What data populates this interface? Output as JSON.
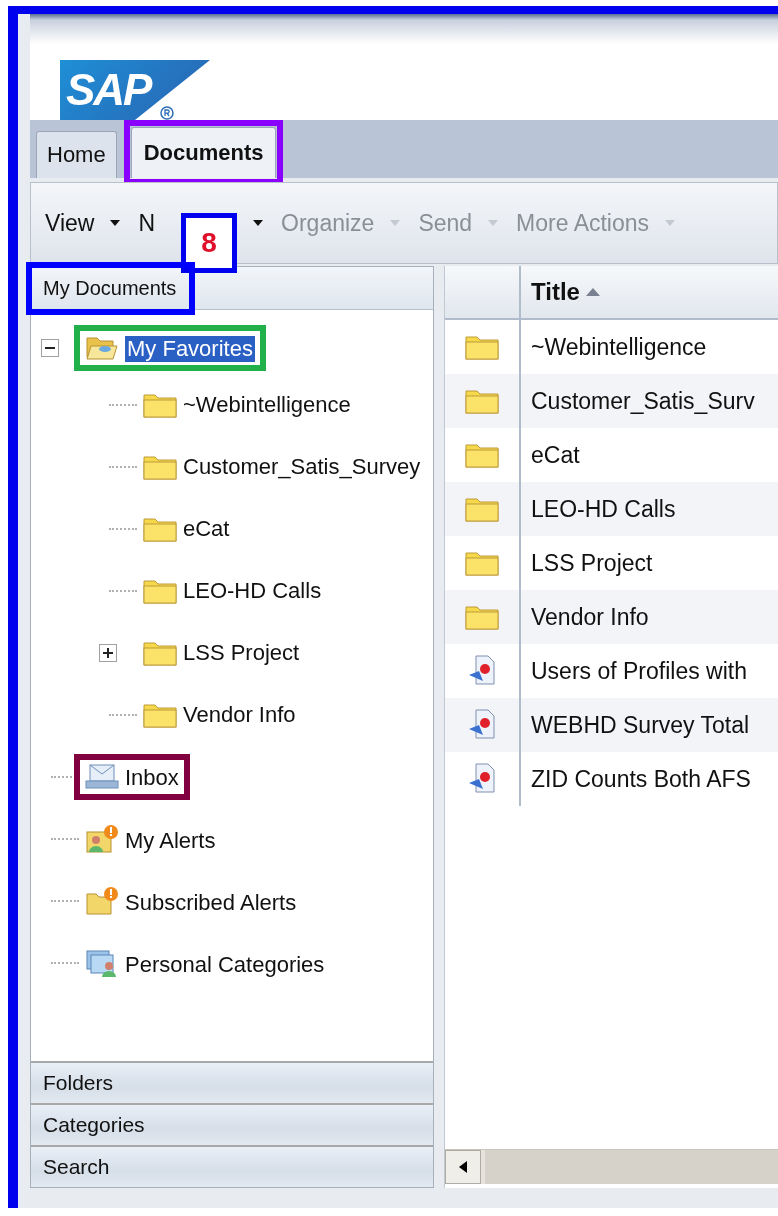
{
  "logo": "SAP",
  "tabs": [
    {
      "label": "Home",
      "selected": false
    },
    {
      "label": "Documents",
      "selected": true,
      "color": "#8a00ff"
    }
  ],
  "toolbar": [
    {
      "label": "View",
      "disabled": false
    },
    {
      "label": "N",
      "disabled": false
    },
    {
      "label": "Organize",
      "disabled": true
    },
    {
      "label": "Send",
      "disabled": true
    },
    {
      "label": "More Actions",
      "disabled": true
    }
  ],
  "callout": {
    "number": "8"
  },
  "left_panel": {
    "title": "My Documents",
    "color": "#0000ff",
    "tree": [
      {
        "label": "My Favorites",
        "kind": "open-folder",
        "expanded": true,
        "selected": true,
        "color": "#22b04a",
        "children": [
          {
            "label": "~Webintelligence",
            "kind": "folder"
          },
          {
            "label": "Customer_Satis_Survey",
            "kind": "folder"
          },
          {
            "label": "eCat",
            "kind": "folder"
          },
          {
            "label": "LEO-HD Calls",
            "kind": "folder"
          },
          {
            "label": "LSS Project",
            "kind": "folder",
            "expanded": false
          },
          {
            "label": "Vendor Info",
            "kind": "folder"
          }
        ]
      },
      {
        "label": "Inbox",
        "kind": "inbox",
        "color": "#800040"
      },
      {
        "label": "My Alerts",
        "kind": "alert-person"
      },
      {
        "label": "Subscribed Alerts",
        "kind": "alert-folder"
      },
      {
        "label": "Personal Categories",
        "kind": "categories"
      }
    ],
    "accordion": [
      "Folders",
      "Categories",
      "Search"
    ]
  },
  "table": {
    "columns": [
      "Title"
    ],
    "rows": [
      {
        "kind": "folder",
        "title": "~Webintelligence"
      },
      {
        "kind": "folder",
        "title": "Customer_Satis_Surv"
      },
      {
        "kind": "folder",
        "title": "eCat"
      },
      {
        "kind": "folder",
        "title": "LEO-HD Calls"
      },
      {
        "kind": "folder",
        "title": "LSS Project"
      },
      {
        "kind": "folder",
        "title": "Vendor Info"
      },
      {
        "kind": "report",
        "title": "Users of Profiles with"
      },
      {
        "kind": "report",
        "title": "WEBHD Survey Total"
      },
      {
        "kind": "report",
        "title": "ZID Counts Both AFS"
      }
    ]
  }
}
